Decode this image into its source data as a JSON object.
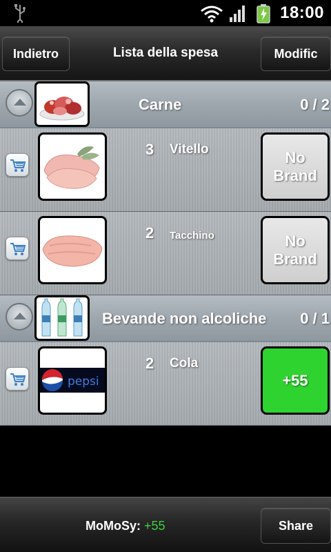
{
  "status": {
    "time": "18:00"
  },
  "header": {
    "back_label": "Indietro",
    "title": "Lista della spesa",
    "edit_label": "Modific"
  },
  "categories": [
    {
      "name": "Carne",
      "count": "0 / 2",
      "items": [
        {
          "qty": "3",
          "name": "Vitello",
          "brand_line1": "No",
          "brand_line2": "Brand"
        },
        {
          "qty": "2",
          "name": "Tacchino",
          "brand_line1": "No",
          "brand_line2": "Brand"
        }
      ]
    },
    {
      "name": "Bevande non alcoliche",
      "count": "0 / 1",
      "items": [
        {
          "qty": "2",
          "name": "Cola",
          "brand_label": "+55",
          "logo_text": "pepsi"
        }
      ]
    }
  ],
  "footer": {
    "brand": "MoMoSy:",
    "points": "+55",
    "share_label": "Share"
  },
  "colors": {
    "score_green": "#2fd32f",
    "points_green": "#3ed13e"
  }
}
